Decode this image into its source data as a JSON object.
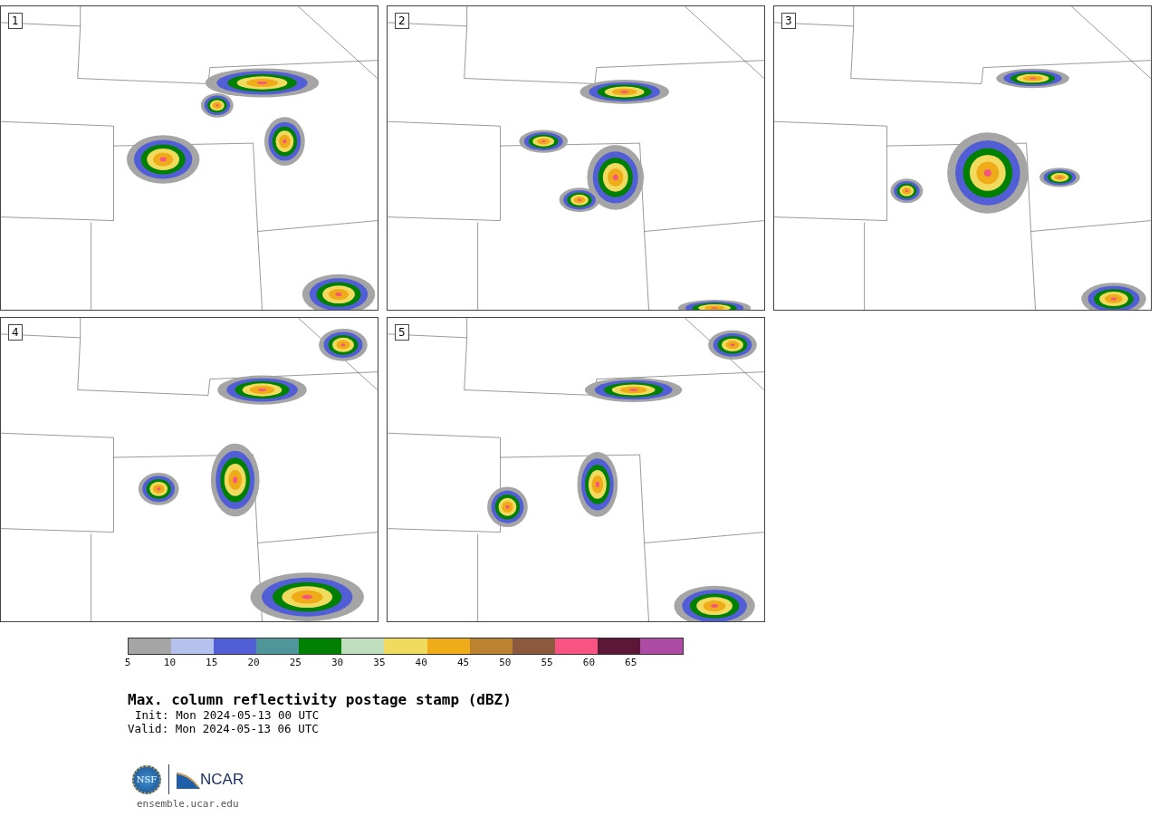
{
  "panels": [
    {
      "number": "1"
    },
    {
      "number": "2"
    },
    {
      "number": "3"
    },
    {
      "number": "4"
    },
    {
      "number": "5"
    }
  ],
  "colorbar": {
    "segments": [
      {
        "color": "#a5a5a5"
      },
      {
        "color": "#b6c2ee"
      },
      {
        "color": "#525ed6"
      },
      {
        "color": "#4f969b"
      },
      {
        "color": "#008000"
      },
      {
        "color": "#bfdfbf"
      },
      {
        "color": "#f0db5e"
      },
      {
        "color": "#f0ab18"
      },
      {
        "color": "#bb8230"
      },
      {
        "color": "#8b5a3e"
      },
      {
        "color": "#f75383"
      },
      {
        "color": "#5d1736"
      },
      {
        "color": "#ad4aa3"
      }
    ],
    "ticks": [
      "5",
      "10",
      "15",
      "20",
      "25",
      "30",
      "35",
      "40",
      "45",
      "50",
      "55",
      "60",
      "65"
    ]
  },
  "title": "Max. column reflectivity postage stamp (dBZ)",
  "init": "Init: Mon 2024-05-13 00 UTC",
  "valid": "Valid: Mon 2024-05-13 06 UTC",
  "logos": [
    {
      "kind": "nsf",
      "text": "NSF"
    },
    {
      "kind": "ncar",
      "text": "NCAR"
    }
  ],
  "url": "ensemble.ucar.edu"
}
